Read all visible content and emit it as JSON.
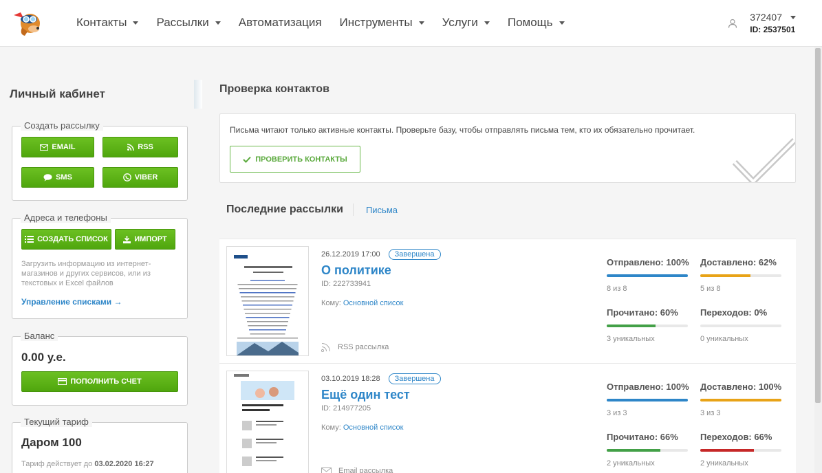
{
  "nav": {
    "items": [
      {
        "label": "Контакты",
        "caret": true
      },
      {
        "label": "Рассылки",
        "caret": true
      },
      {
        "label": "Автоматизация",
        "caret": false
      },
      {
        "label": "Инструменты",
        "caret": true
      },
      {
        "label": "Услуги",
        "caret": true
      },
      {
        "label": "Помощь",
        "caret": true
      }
    ]
  },
  "user": {
    "number": "372407",
    "id": "ID: 2537501"
  },
  "sidebar": {
    "title": "Личный кабинет",
    "create": {
      "legend": "Создать рассылку",
      "email": "EMAIL",
      "rss": "RSS",
      "sms": "SMS",
      "viber": "VIBER"
    },
    "contacts": {
      "legend": "Адреса и телефоны",
      "create_list": "СОЗДАТЬ СПИСОК",
      "import": "ИМПОРТ",
      "hint": "Загрузить информацию из интернет-магазинов и других сервисов, или из текстовых и Excel файлов",
      "manage_link": "Управление списками →"
    },
    "balance": {
      "legend": "Баланс",
      "value": "0.00 у.е.",
      "topup": "ПОПОЛНИТЬ СЧЕТ"
    },
    "tariff": {
      "legend": "Текущий тариф",
      "name": "Даром 100",
      "valid_prefix": "Тариф действует до ",
      "valid_date": "03.02.2020 16:27"
    }
  },
  "main": {
    "title": "Проверка контактов",
    "check_text": "Письма читают только активные контакты. Проверьте базу, чтобы отправлять письма тем, кто их обязательно прочитает.",
    "check_button": "ПРОВЕРИТЬ КОНТАКТЫ",
    "tab_active": "Последние рассылки",
    "tab_letters": "Письма"
  },
  "campaigns": [
    {
      "date": "26.12.2019 17:00",
      "status": "Завершена",
      "name": "О политике",
      "id": "ID: 222733941",
      "to_label": "Кому: ",
      "to_list": "Основной список",
      "type": "RSS рассылка",
      "stats": [
        {
          "label": "Отправлено: 100%",
          "sub": "8 из 8",
          "percent": 100,
          "color": "#2e86c8"
        },
        {
          "label": "Доставлено: 62%",
          "sub": "5 из 8",
          "percent": 62,
          "color": "#e8a317"
        },
        {
          "label": "Прочитано: 60%",
          "sub": "3 уникальных",
          "percent": 60,
          "color": "#43a047"
        },
        {
          "label": "Переходов: 0%",
          "sub": "0 уникальных",
          "percent": 0,
          "color": "#c62828"
        }
      ]
    },
    {
      "date": "03.10.2019 18:28",
      "status": "Завершена",
      "name": "Ещё один тест",
      "id": "ID: 214977205",
      "to_label": "Кому: ",
      "to_list": "Основной список",
      "type": "Email рассылка",
      "stats": [
        {
          "label": "Отправлено: 100%",
          "sub": "3 из 3",
          "percent": 100,
          "color": "#2e86c8"
        },
        {
          "label": "Доставлено: 100%",
          "sub": "3 из 3",
          "percent": 100,
          "color": "#e8a317"
        },
        {
          "label": "Прочитано: 66%",
          "sub": "2 уникальных",
          "percent": 66,
          "color": "#43a047"
        },
        {
          "label": "Переходов: 66%",
          "sub": "2 уникальных",
          "percent": 66,
          "color": "#c62828"
        }
      ]
    }
  ]
}
